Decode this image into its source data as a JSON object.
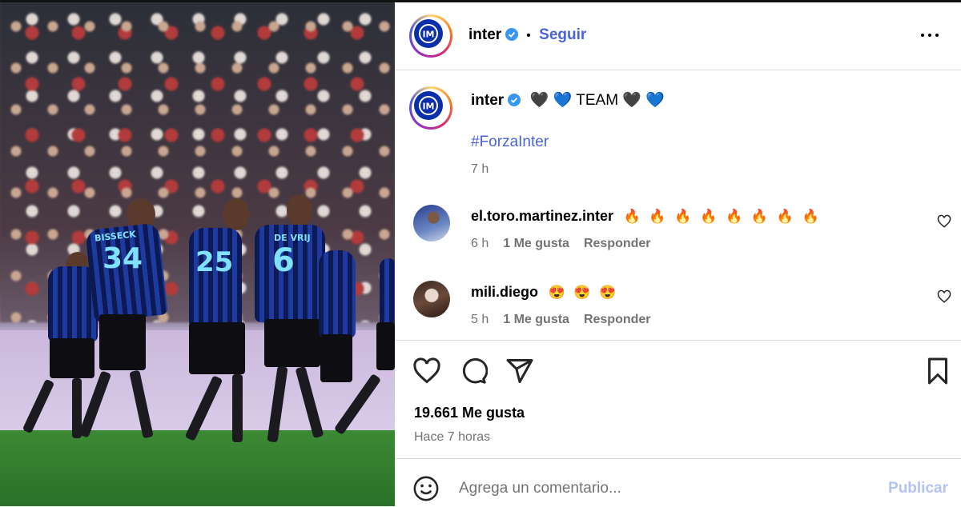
{
  "post": {
    "author": "inter",
    "follow_label": "Seguir",
    "dot": "•",
    "caption": {
      "username": "inter",
      "text": "🖤 💙 TEAM 🖤 💙",
      "hashtag": "#ForzaInter",
      "time": "7 h"
    },
    "comments": [
      {
        "username": "el.toro.martinez.inter",
        "text": "🔥 🔥 🔥 🔥 🔥 🔥 🔥 🔥",
        "time": "6 h",
        "likes": "1 Me gusta",
        "reply": "Responder"
      },
      {
        "username": "mili.diego",
        "text": "😍 😍 😍",
        "time": "5 h",
        "likes": "1 Me gusta",
        "reply": "Responder"
      }
    ],
    "likes_count": "19.661 Me gusta",
    "posted_ago": "Hace 7 horas",
    "comment_placeholder": "Agrega un comentario...",
    "publish_label": "Publicar"
  },
  "photo": {
    "jersey_numbers": [
      "34",
      "6",
      "25"
    ],
    "jersey_names": [
      "BISSECK",
      "DE VRIJ"
    ]
  },
  "colors": {
    "accent": "#4a63d8",
    "publish_disabled": "#b3c3f5",
    "meta_text": "#737373",
    "inter_blue": "#0b2fa8"
  },
  "icons": [
    "verified-icon",
    "more-options-icon",
    "heart-icon",
    "comment-icon",
    "share-icon",
    "bookmark-icon",
    "emoji-icon"
  ]
}
